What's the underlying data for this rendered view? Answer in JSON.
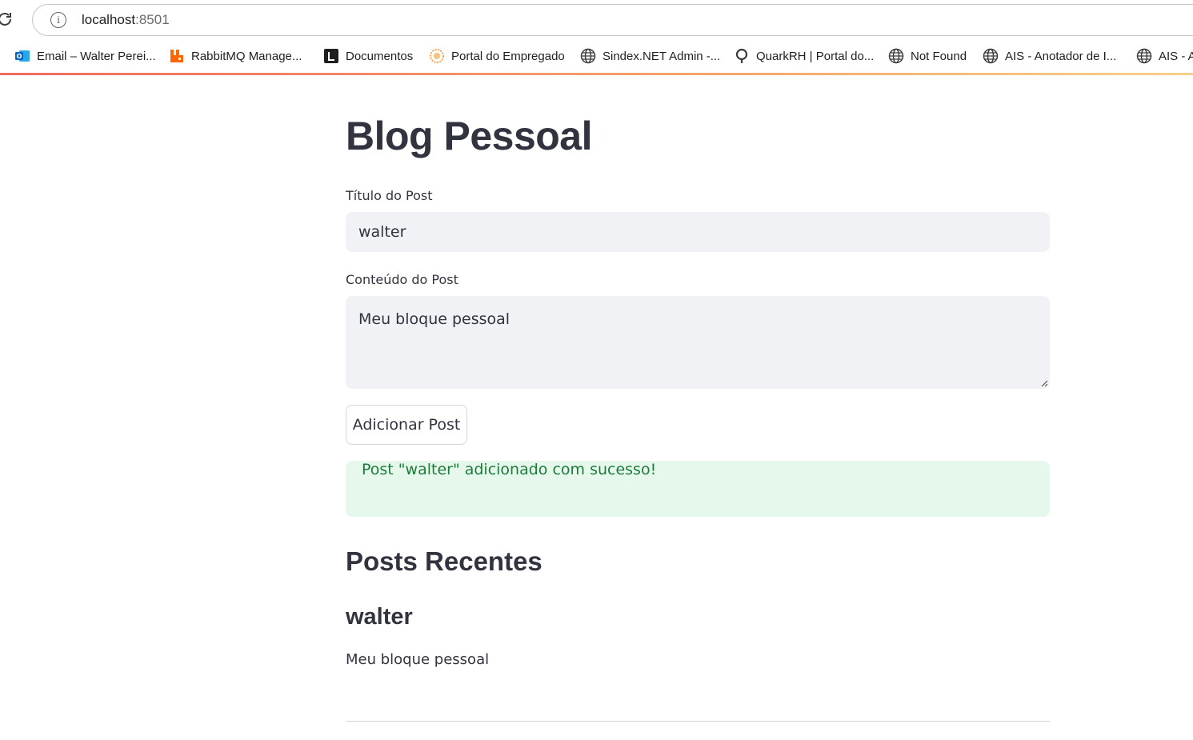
{
  "browser": {
    "url_host": "localhost",
    "url_port": ":8501",
    "bookmarks": [
      {
        "label": "Email – Walter Perei...",
        "icon": "outlook-icon"
      },
      {
        "label": "RabbitMQ Manage...",
        "icon": "rabbitmq-icon"
      },
      {
        "label": "Documentos",
        "icon": "documentos-icon"
      },
      {
        "label": "Portal do Empregado",
        "icon": "portal-icon"
      },
      {
        "label": "Sindex.NET Admin -...",
        "icon": "globe-icon"
      },
      {
        "label": "QuarkRH | Portal do...",
        "icon": "quark-icon"
      },
      {
        "label": "Not Found",
        "icon": "globe-icon"
      },
      {
        "label": "AIS - Anotador de I...",
        "icon": "globe-icon"
      },
      {
        "label": "AIS - A",
        "icon": "globe-icon"
      }
    ],
    "accent_gradient": [
      "#f06b5e",
      "#f5a56a",
      "#f7d089"
    ]
  },
  "app": {
    "title": "Blog Pessoal",
    "form": {
      "title_label": "Título do Post",
      "title_value": "walter",
      "content_label": "Conteúdo do Post",
      "content_value": "Meu bloque pessoal",
      "submit_label": "Adicionar Post"
    },
    "success_message": "Post \"walter\" adicionado com sucesso!",
    "recent_heading": "Posts Recentes",
    "posts": [
      {
        "title": "walter",
        "content": "Meu bloque pessoal"
      }
    ],
    "colors": {
      "text": "#31333f",
      "input_bg": "#f0f2f6",
      "success_bg": "#e6f8ec",
      "success_text": "#1d7a3a"
    }
  }
}
